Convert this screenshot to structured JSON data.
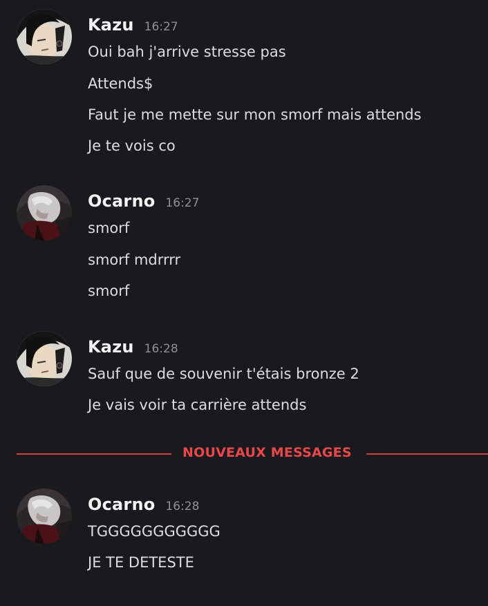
{
  "messages": [
    {
      "author": "Kazu",
      "time": "16:27",
      "avatar": "kazu-avatar",
      "lines": [
        "Oui bah j'arrive stresse pas",
        "Attends$",
        "Faut je me mette sur mon smorf mais attends",
        "Je te vois co"
      ]
    },
    {
      "author": "Ocarno",
      "time": "16:27",
      "avatar": "ocarno-avatar",
      "lines": [
        "smorf",
        "smorf mdrrrr",
        "smorf"
      ]
    },
    {
      "author": "Kazu",
      "time": "16:28",
      "avatar": "kazu-avatar",
      "lines": [
        "Sauf que de souvenir t'étais bronze 2",
        "Je vais voir ta carrière attends"
      ]
    },
    {
      "author": "Ocarno",
      "time": "16:28",
      "avatar": "ocarno-avatar",
      "lines": [
        "TGGGGGGGGGGG",
        "JE TE DETESTE"
      ]
    }
  ],
  "divider": {
    "label": "NOUVEAUX MESSAGES",
    "color": "#e8484b"
  },
  "colors": {
    "background": "#1a1a1e",
    "username": "#f2f3f5",
    "timestamp": "#8e9099",
    "message": "#dbdee1"
  }
}
